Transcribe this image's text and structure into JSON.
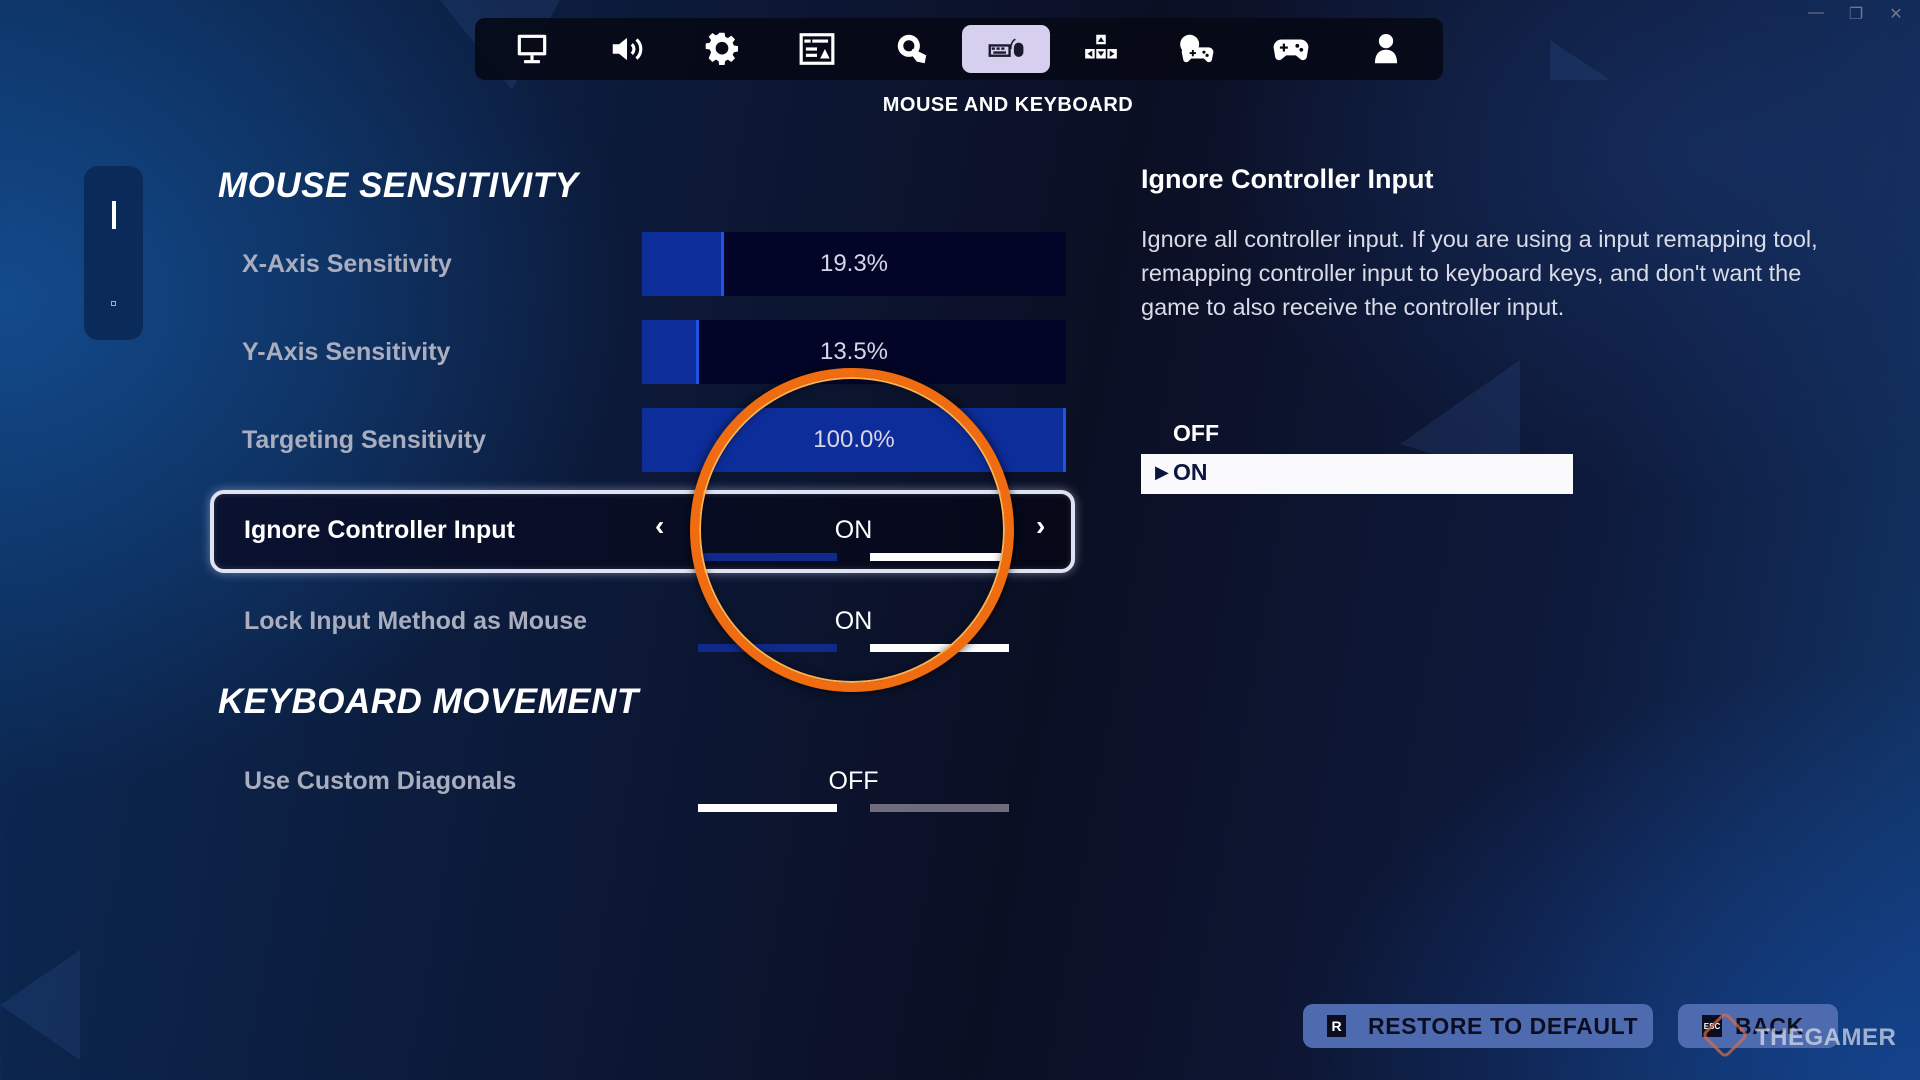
{
  "window_controls": {
    "minimize": "—",
    "maximize": "❐",
    "close": "✕"
  },
  "tabs": [
    {
      "icon": "monitor-icon",
      "label": "Display",
      "active": false
    },
    {
      "icon": "speaker-icon",
      "label": "Audio",
      "active": false
    },
    {
      "icon": "gear-icon",
      "label": "Game",
      "active": false
    },
    {
      "icon": "interface-window-icon",
      "label": "Interface",
      "active": false
    },
    {
      "icon": "gear-touch-icon",
      "label": "Accessibility",
      "active": false
    },
    {
      "icon": "keyboard-mouse-icon",
      "label": "Mouse and Keyboard",
      "active": true
    },
    {
      "icon": "arrow-keys-icon",
      "label": "Keyboard Controls",
      "active": false
    },
    {
      "icon": "gear-controller-icon",
      "label": "Controller",
      "active": false
    },
    {
      "icon": "controller-icon",
      "label": "Controller Bindings",
      "active": false
    },
    {
      "icon": "person-icon",
      "label": "Account and Privacy",
      "active": false
    }
  ],
  "section_title": "MOUSE AND KEYBOARD",
  "settings": {
    "mouse_heading": "MOUSE SENSITIVITY",
    "x_axis": {
      "label": "X-Axis Sensitivity",
      "value": "19.3%",
      "fraction": 0.193
    },
    "y_axis": {
      "label": "Y-Axis Sensitivity",
      "value": "13.5%",
      "fraction": 0.135
    },
    "targeting": {
      "label": "Targeting Sensitivity",
      "value": "100.0%",
      "fraction": 1.0
    },
    "ignore_controller": {
      "label": "Ignore Controller Input",
      "value": "ON",
      "prev": "‹",
      "next": "›"
    },
    "lock_input": {
      "label": "Lock Input Method as Mouse",
      "value": "ON"
    },
    "keyboard_heading": "KEYBOARD MOVEMENT",
    "custom_diagonals": {
      "label": "Use Custom Diagonals",
      "value": "OFF"
    }
  },
  "detail": {
    "title": "Ignore Controller Input",
    "description": "Ignore all controller input.  If you are using a input remapping tool, remapping controller input to keyboard keys, and don't want the game to also receive the controller input.",
    "options": [
      "OFF",
      "ON"
    ],
    "selected": "ON",
    "caret": "▶"
  },
  "footer": {
    "restore": {
      "key": "R",
      "label": "RESTORE TO DEFAULT"
    },
    "back": {
      "key": "ESC",
      "label": "BACK"
    }
  },
  "watermark": "THEGAMER"
}
